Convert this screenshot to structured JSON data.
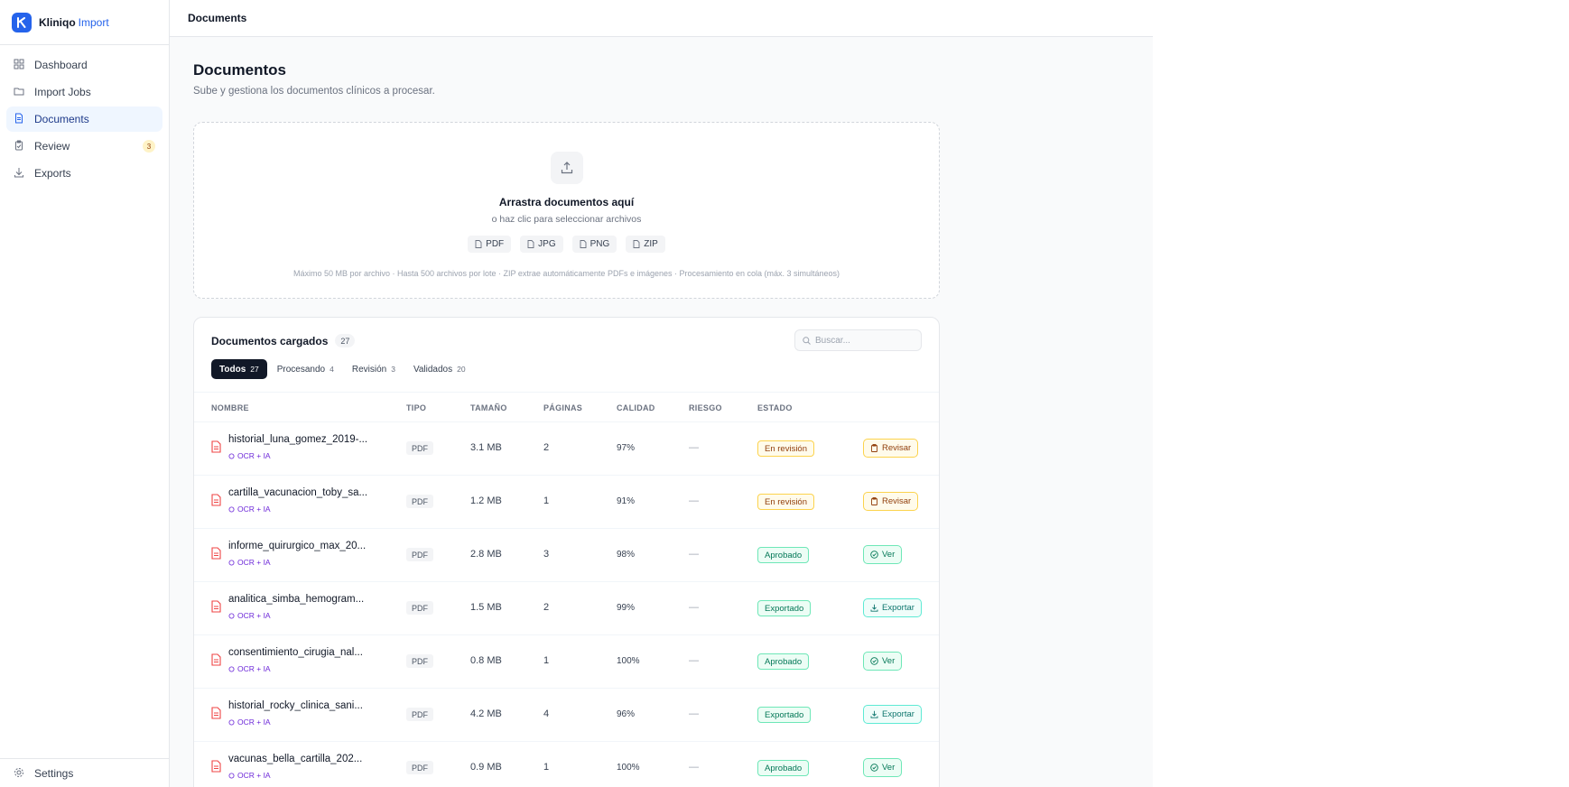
{
  "brand": {
    "name": "Kliniqo",
    "accent": "Import"
  },
  "sidebar": {
    "items": [
      {
        "label": "Dashboard",
        "icon": "grid-icon"
      },
      {
        "label": "Import Jobs",
        "icon": "folder-icon"
      },
      {
        "label": "Documents",
        "icon": "document-icon",
        "active": true
      },
      {
        "label": "Review",
        "icon": "clipboard-icon",
        "badge": "3"
      },
      {
        "label": "Exports",
        "icon": "download-icon"
      }
    ],
    "footer": {
      "label": "Settings",
      "icon": "gear-icon"
    }
  },
  "topbar": {
    "title": "Documents"
  },
  "page": {
    "title": "Documentos",
    "subtitle": "Sube y gestiona los documentos clínicos a procesar."
  },
  "dropzone": {
    "title": "Arrastra documentos aquí",
    "subtitle": "o haz clic para seleccionar archivos",
    "formats": [
      "PDF",
      "JPG",
      "PNG",
      "ZIP"
    ],
    "note": "Máximo 50 MB por archivo · Hasta 500 archivos por lote · ZIP extrae automáticamente PDFs e imágenes · Procesamiento en cola (máx. 3 simultáneos)"
  },
  "table": {
    "title": "Documentos cargados",
    "count": "27",
    "search_placeholder": "Buscar...",
    "tabs": [
      {
        "label": "Todos",
        "count": "27",
        "active": true
      },
      {
        "label": "Procesando",
        "count": "4"
      },
      {
        "label": "Revisión",
        "count": "3"
      },
      {
        "label": "Validados",
        "count": "20"
      }
    ],
    "columns": [
      "NOMBRE",
      "TIPO",
      "TAMAÑO",
      "PÁGINAS",
      "CALIDAD",
      "RIESGO",
      "ESTADO"
    ],
    "rows": [
      {
        "name": "historial_luna_gomez_2019-...",
        "tag": "OCR + IA",
        "type": "PDF",
        "size": "3.1 MB",
        "pages": "2",
        "quality": "97%",
        "risk": "—",
        "status": "En revisión",
        "status_kind": "review",
        "action": "Revisar",
        "action_kind": "review"
      },
      {
        "name": "cartilla_vacunacion_toby_sa...",
        "tag": "OCR + IA",
        "type": "PDF",
        "size": "1.2 MB",
        "pages": "1",
        "quality": "91%",
        "risk": "—",
        "status": "En revisión",
        "status_kind": "review",
        "action": "Revisar",
        "action_kind": "review"
      },
      {
        "name": "informe_quirurgico_max_20...",
        "tag": "OCR + IA",
        "type": "PDF",
        "size": "2.8 MB",
        "pages": "3",
        "quality": "98%",
        "risk": "—",
        "status": "Aprobado",
        "status_kind": "ok",
        "action": "Ver",
        "action_kind": "ok"
      },
      {
        "name": "analitica_simba_hemogram...",
        "tag": "OCR + IA",
        "type": "PDF",
        "size": "1.5 MB",
        "pages": "2",
        "quality": "99%",
        "risk": "—",
        "status": "Exportado",
        "status_kind": "ok",
        "action": "Exportar",
        "action_kind": "exp"
      },
      {
        "name": "consentimiento_cirugia_nal...",
        "tag": "OCR + IA",
        "type": "PDF",
        "size": "0.8 MB",
        "pages": "1",
        "quality": "100%",
        "risk": "—",
        "status": "Aprobado",
        "status_kind": "ok",
        "action": "Ver",
        "action_kind": "ok"
      },
      {
        "name": "historial_rocky_clinica_sani...",
        "tag": "OCR + IA",
        "type": "PDF",
        "size": "4.2 MB",
        "pages": "4",
        "quality": "96%",
        "risk": "—",
        "status": "Exportado",
        "status_kind": "ok",
        "action": "Exportar",
        "action_kind": "exp"
      },
      {
        "name": "vacunas_bella_cartilla_202...",
        "tag": "OCR + IA",
        "type": "PDF",
        "size": "0.9 MB",
        "pages": "1",
        "quality": "100%",
        "risk": "—",
        "status": "Aprobado",
        "status_kind": "ok",
        "action": "Ver",
        "action_kind": "ok"
      }
    ]
  },
  "colors": {
    "primary": "#2563eb",
    "review": "#92400e",
    "approved": "#047857",
    "file_icon": "#ef4444",
    "ocr_tag": "#6d28d9"
  }
}
